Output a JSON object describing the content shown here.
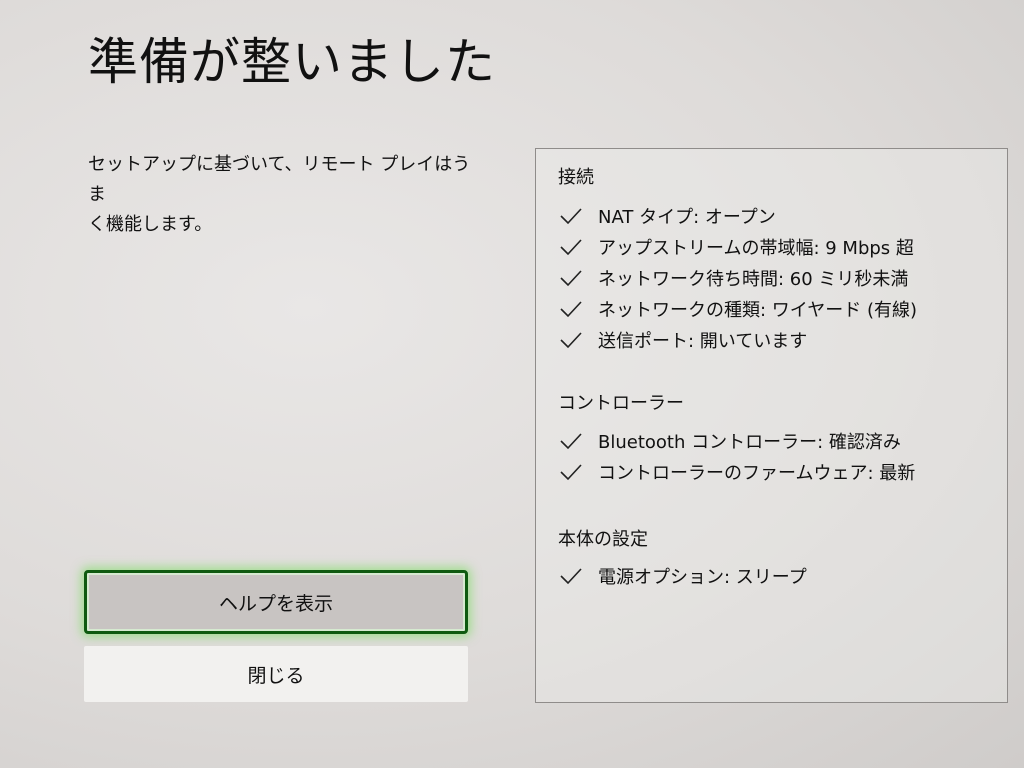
{
  "header": {
    "title": "準備が整いました"
  },
  "main": {
    "description_line1": "セットアップに基づいて、リモート プレイはうま",
    "description_line2": "く機能します。",
    "help_button_label": "ヘルプを表示",
    "close_button_label": "閉じる"
  },
  "panel": {
    "connection": {
      "title": "接続",
      "items": [
        "NAT タイプ: オープン",
        "アップストリームの帯域幅: 9 Mbps 超",
        "ネットワーク待ち時間: 60 ミリ秒未満",
        "ネットワークの種類: ワイヤード (有線)",
        "送信ポート: 開いています"
      ]
    },
    "controller": {
      "title": "コントローラー",
      "items": [
        "Bluetooth コントローラー: 確認済み",
        "コントローラーのファームウェア: 最新"
      ]
    },
    "console": {
      "title": "本体の設定",
      "items": [
        "電源オプション: スリープ"
      ]
    }
  },
  "icons": {
    "check": "check-icon"
  },
  "colors": {
    "focus_border": "#0f5a10",
    "focus_glow": "#6edc50",
    "background": "#dedbd9",
    "close_button_bg": "#f2f1ef"
  }
}
